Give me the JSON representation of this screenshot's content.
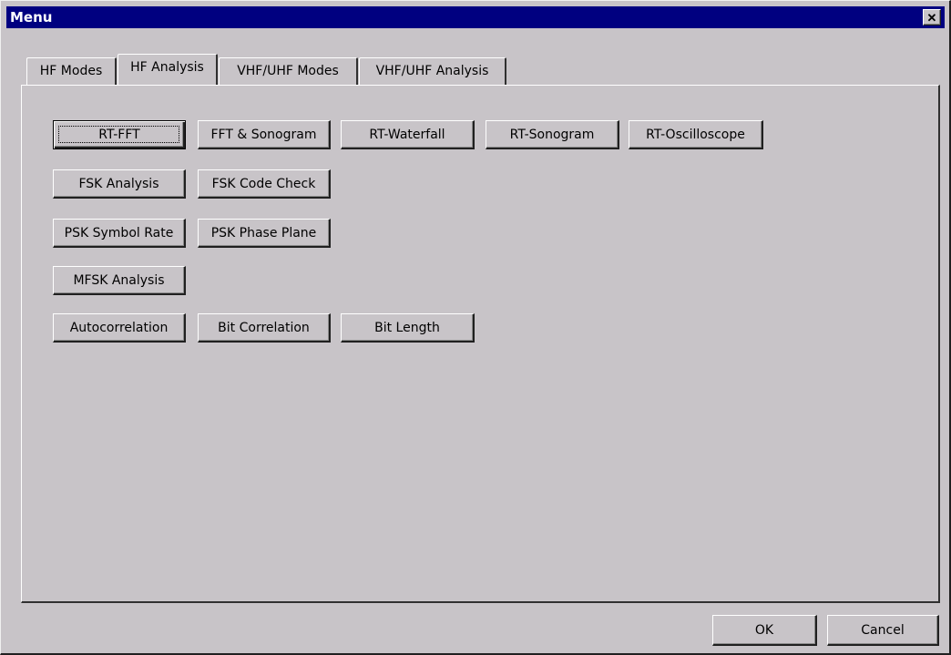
{
  "window": {
    "title": "Menu",
    "close_symbol": "✕"
  },
  "tabs": [
    {
      "label": "HF Modes",
      "active": false
    },
    {
      "label": "HF Analysis",
      "active": true
    },
    {
      "label": "VHF/UHF Modes",
      "active": false
    },
    {
      "label": "VHF/UHF Analysis",
      "active": false
    }
  ],
  "analysis_buttons": {
    "rt_fft": "RT-FFT",
    "fft_sonogram": "FFT & Sonogram",
    "rt_waterfall": "RT-Waterfall",
    "rt_sonogram": "RT-Sonogram",
    "rt_oscilloscope": "RT-Oscilloscope",
    "fsk_analysis": "FSK Analysis",
    "fsk_code_check": "FSK Code Check",
    "psk_symbol_rate": "PSK Symbol Rate",
    "psk_phase_plane": "PSK Phase Plane",
    "mfsk_analysis": "MFSK Analysis",
    "autocorrelation": "Autocorrelation",
    "bit_correlation": "Bit Correlation",
    "bit_length": "Bit Length"
  },
  "footer": {
    "ok": "OK",
    "cancel": "Cancel"
  }
}
